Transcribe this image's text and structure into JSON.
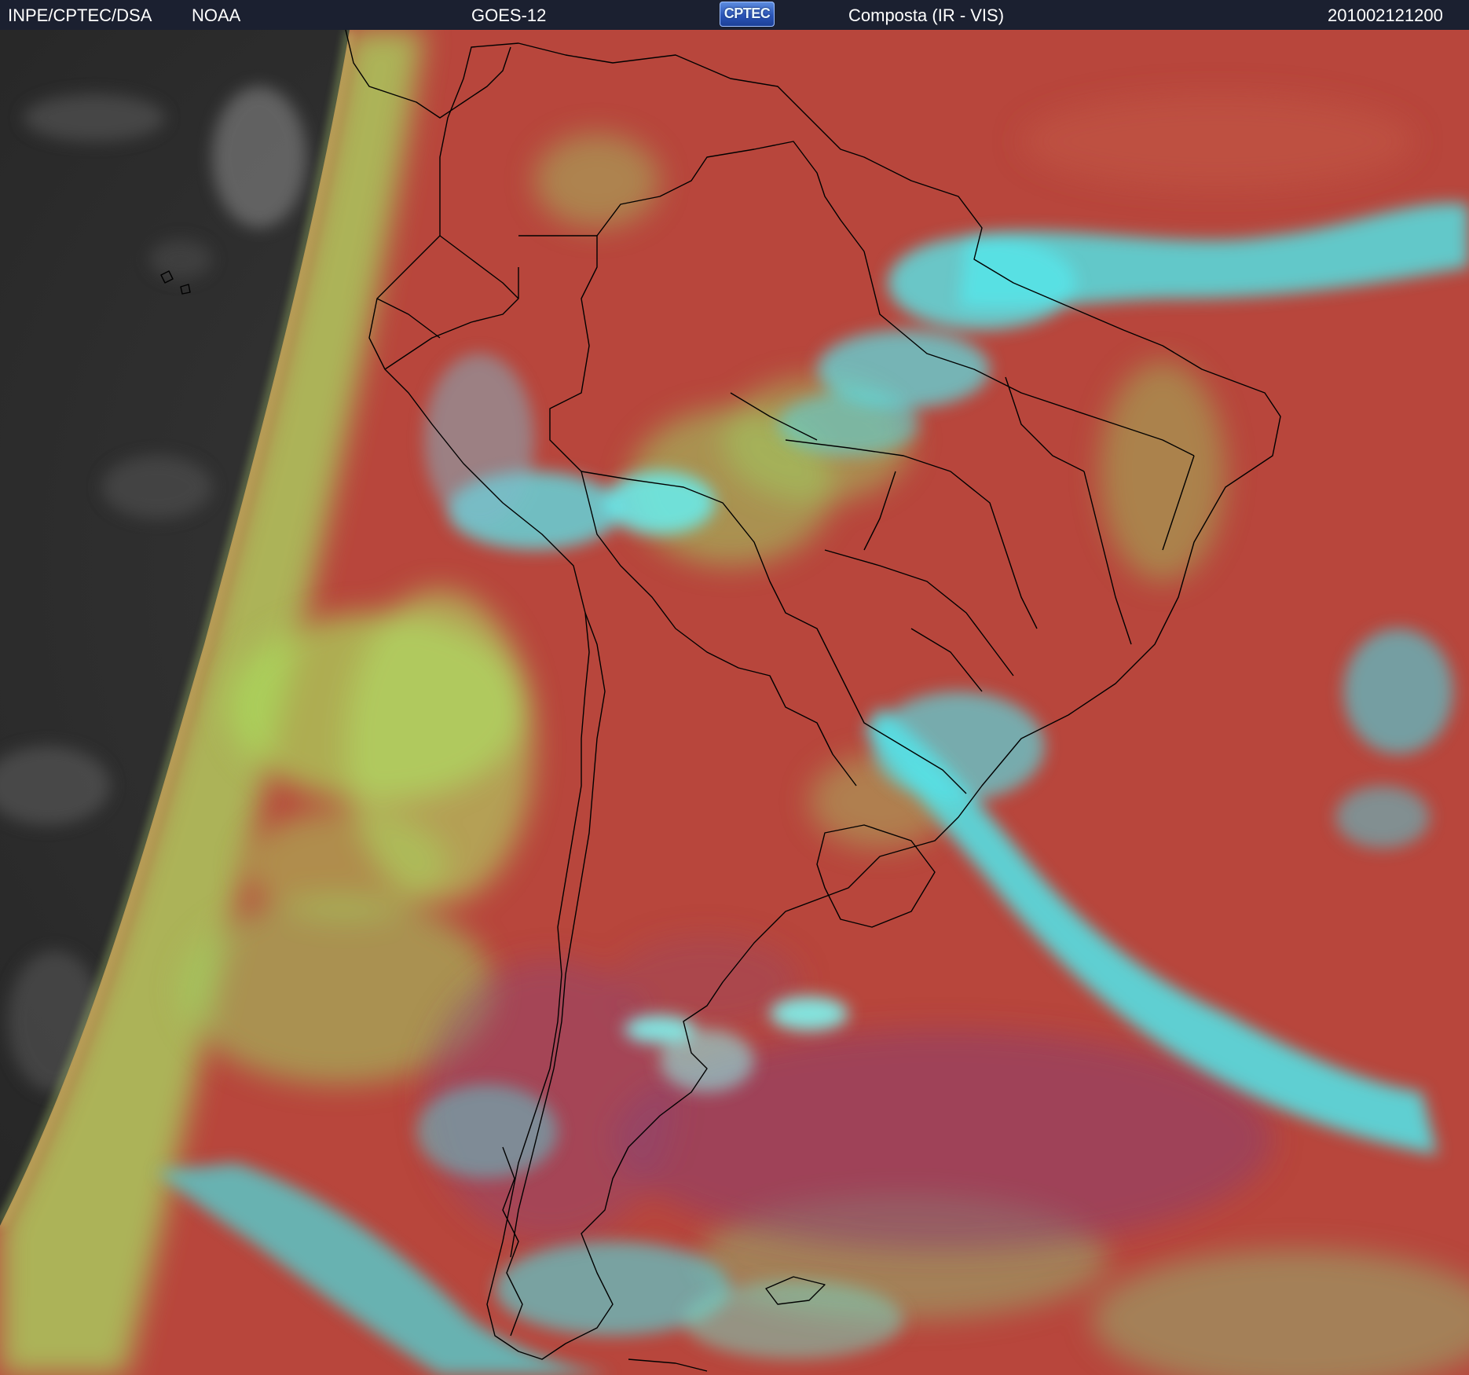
{
  "header": {
    "source": "INPE/CPTEC/DSA",
    "agency": "NOAA",
    "satellite": "GOES-12",
    "logo_text": "CPTEC",
    "product": "Composta (IR - VIS)",
    "timestamp": "201002121200"
  },
  "colors": {
    "header_bg": "#1b2030",
    "clear_ocean_land": "#b8463c",
    "high_cloud": "#3fe6ea",
    "low_cloud": "#a6d85a",
    "night_side": "#303030",
    "boundaries": "#000000"
  }
}
